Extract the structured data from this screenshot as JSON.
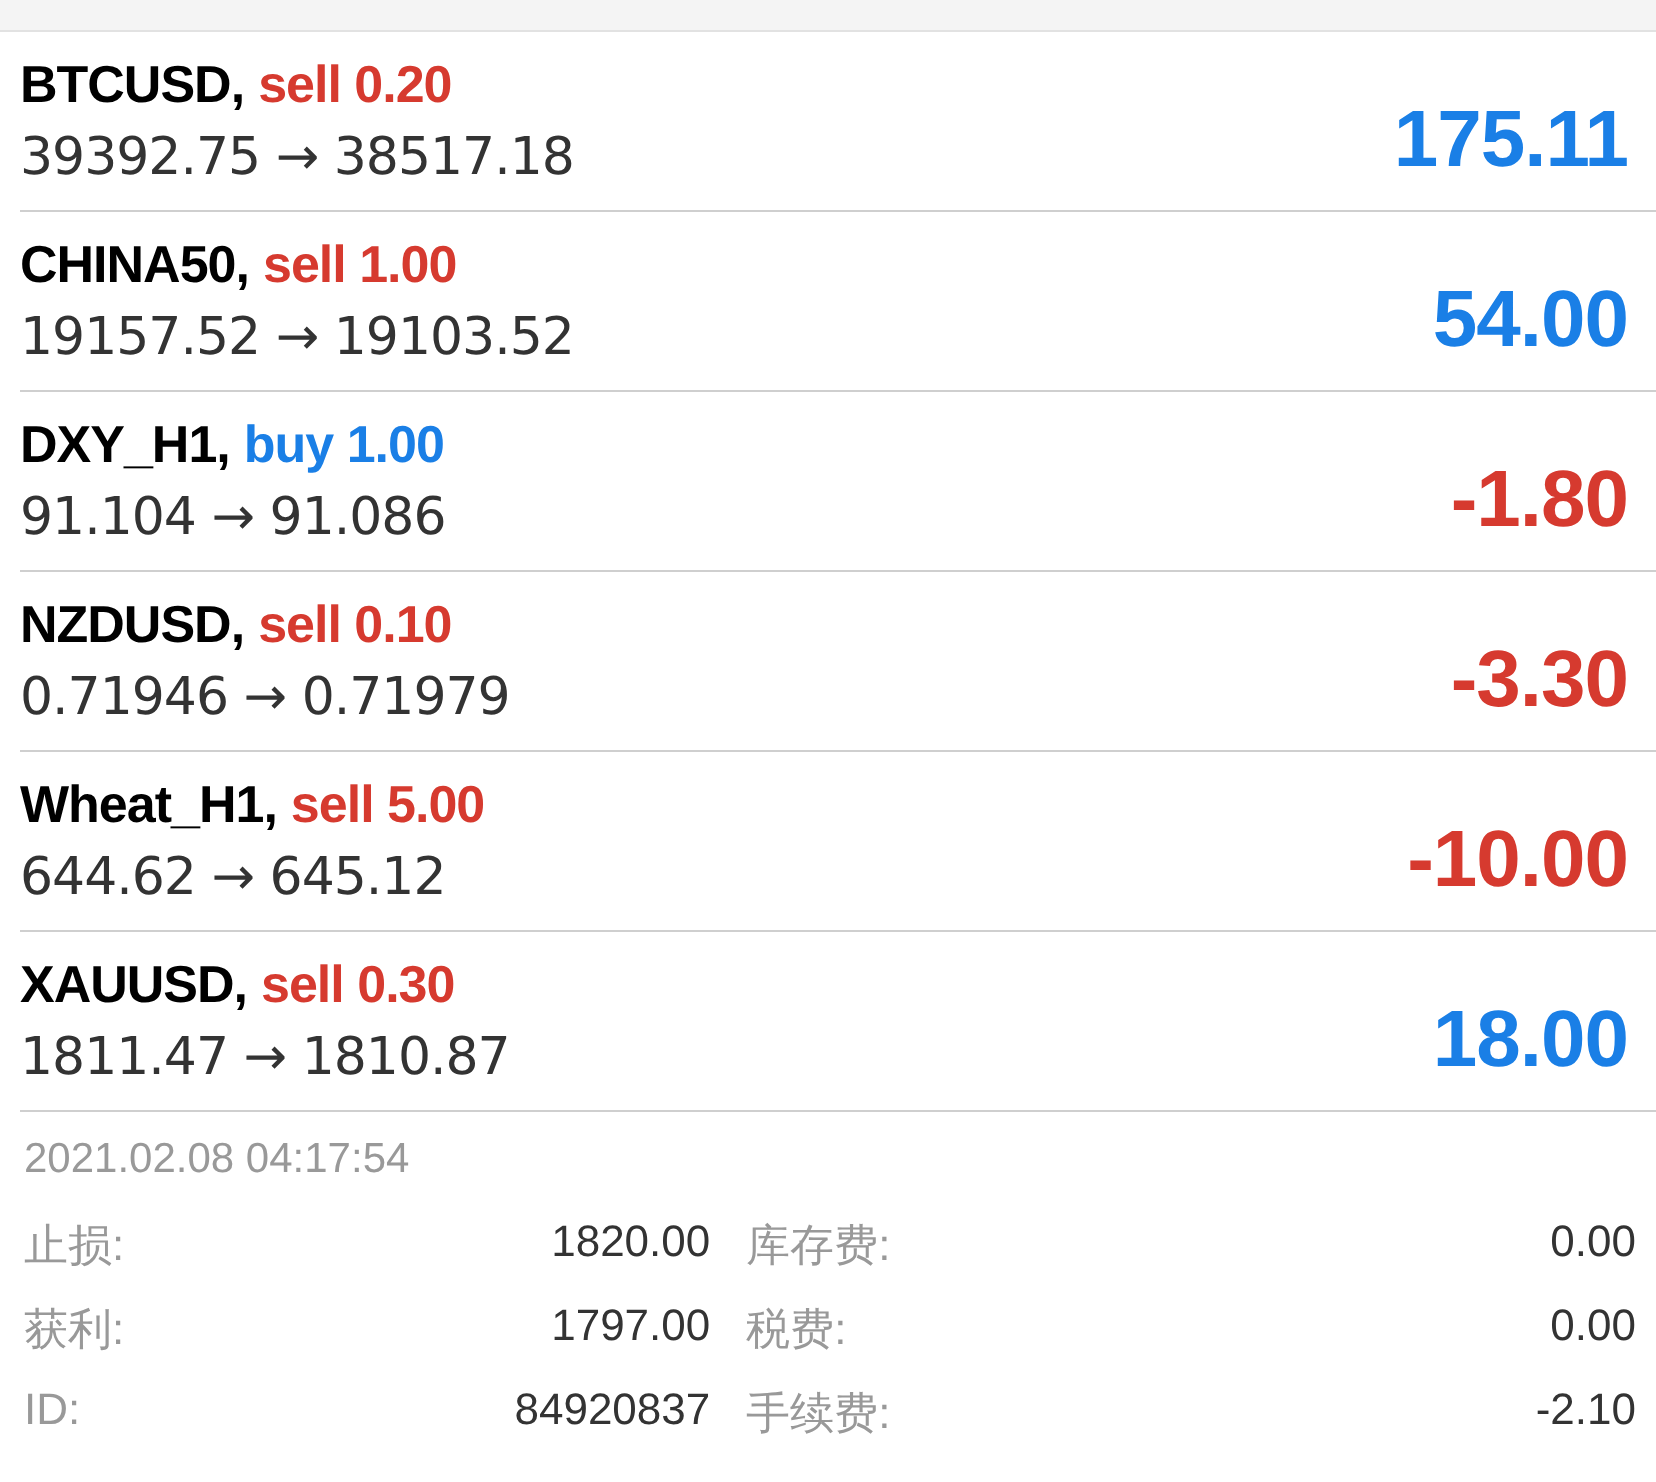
{
  "positions": [
    {
      "symbol": "BTCUSD,",
      "volume": {
        "text": "sell 0.20",
        "color": "#d63a2f"
      },
      "prices": "39392.75 → 38517.18",
      "profit": {
        "text": "175.11",
        "color": "#1a7fe6"
      }
    },
    {
      "symbol": "CHINA50,",
      "volume": {
        "text": "sell 1.00",
        "color": "#d63a2f"
      },
      "prices": "19157.52 → 19103.52",
      "profit": {
        "text": "54.00",
        "color": "#1a7fe6"
      }
    },
    {
      "symbol": "DXY_H1,",
      "volume": {
        "text": "buy 1.00",
        "color": "#1a7fe6"
      },
      "prices": "91.104 → 91.086",
      "profit": {
        "text": "-1.80",
        "color": "#d63a2f"
      }
    },
    {
      "symbol": "NZDUSD,",
      "volume": {
        "text": "sell 0.10",
        "color": "#d63a2f"
      },
      "prices": "0.71946 → 0.71979",
      "profit": {
        "text": "-3.30",
        "color": "#d63a2f"
      }
    },
    {
      "symbol": "Wheat_H1,",
      "volume": {
        "text": "sell 5.00",
        "color": "#d63a2f"
      },
      "prices": "644.62 → 645.12",
      "profit": {
        "text": "-10.00",
        "color": "#d63a2f"
      }
    },
    {
      "symbol": "XAUUSD,",
      "volume": {
        "text": "sell 0.30",
        "color": "#d63a2f"
      },
      "prices": "1811.47 → 1810.87",
      "profit": {
        "text": "18.00",
        "color": "#1a7fe6"
      }
    }
  ],
  "details": {
    "time": "2021.02.08 04:17:54",
    "rows": [
      {
        "label": "止损:",
        "value": "1820.00",
        "label_2": "库存费:",
        "value_2": "0.00"
      },
      {
        "label": "获利:",
        "value": "1797.00",
        "label_2": "税费:",
        "value_2": "0.00"
      },
      {
        "label": "ID:",
        "value": "84920837",
        "label_2": "手续费:",
        "value_2": "-2.10"
      }
    ]
  }
}
